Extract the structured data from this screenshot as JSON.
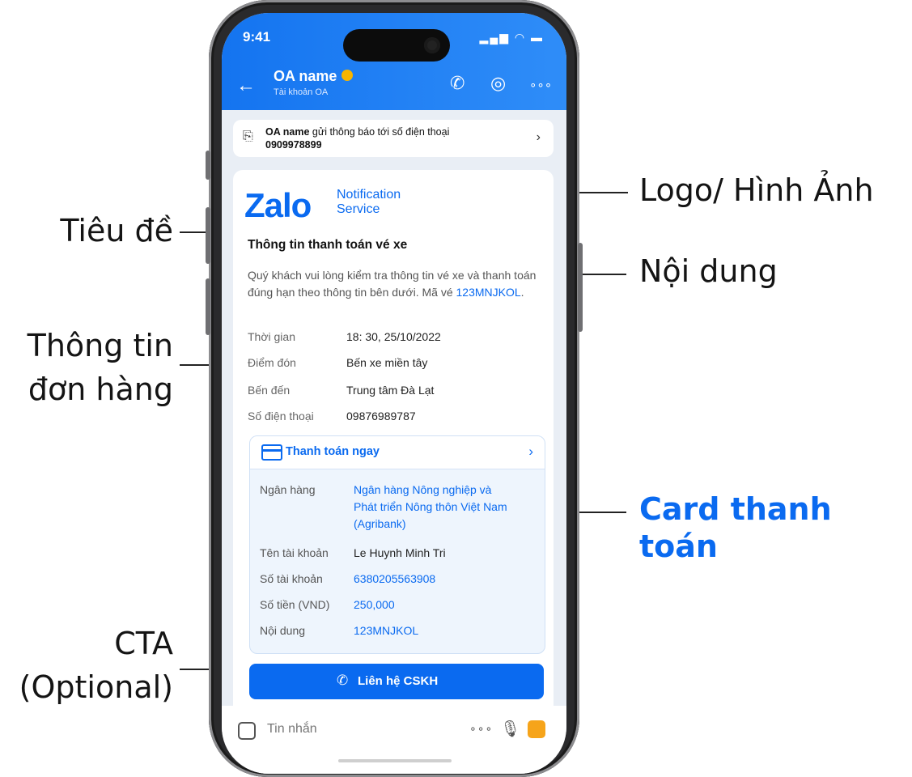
{
  "annotations": {
    "logo": "Logo/ Hình Ảnh",
    "title": "Tiêu đề",
    "content": "Nội dung",
    "order_info_line1": "Thông tin",
    "order_info_line2": "đơn hàng",
    "payment_card": "Card thanh toán",
    "cta_line1": "CTA",
    "cta_line2": "(Optional)"
  },
  "status_bar": {
    "time": "9:41",
    "indicators": "▂▄▆ ◠ ▬"
  },
  "header": {
    "back_icon": "←",
    "oa_name": "OA name",
    "oa_subtitle": "Tài khoản OA",
    "call_icon": "✆",
    "camera_icon": "◎",
    "more_icon": "∘∘∘"
  },
  "notice": {
    "icon": "⎘",
    "sender": "OA name",
    "text": " gửi thông báo tới số điện thoại",
    "phone": "0909978899",
    "chevron": "›"
  },
  "card": {
    "logo_brand": "Zalo",
    "logo_sub1": "Notification",
    "logo_sub2": "Service",
    "title": "Thông tin thanh toán vé xe",
    "body": "Quý khách vui lòng kiểm tra thông tin vé xe và thanh toán đúng hạn theo thông tin bên dưới. Mã vé ",
    "ticket_code": "123MNJKOL",
    "body_end": ".",
    "info": [
      {
        "key": "Thời gian",
        "value": "18: 30, 25/10/2022"
      },
      {
        "key": "Điểm đón",
        "value": "Bến xe miền tây"
      },
      {
        "key": "Bến đến",
        "value": "Trung tâm Đà Lạt"
      },
      {
        "key": "Số điện thoại",
        "value": "09876989787"
      }
    ],
    "payment": {
      "header_label": "Thanh toán ngay",
      "chevron": "›",
      "rows": [
        {
          "key": "Ngân hàng",
          "value": "Ngân hàng Nông nghiệp và Phát triển Nông thôn Việt Nam (Agribank)"
        },
        {
          "key": "Tên tài khoản",
          "value": "Le Huynh Minh Tri"
        },
        {
          "key": "Số tài khoản",
          "value": "6380205563908"
        },
        {
          "key": "Số tiền (VND)",
          "value": "250,000"
        },
        {
          "key": "Nội dung",
          "value": "123MNJKOL"
        }
      ]
    },
    "cta": {
      "icon": "✆",
      "label": "Liên hệ CSKH"
    }
  },
  "input_bar": {
    "placeholder": "Tin nhắn",
    "more_icon": "∘∘∘",
    "mic_icon": "🎙"
  }
}
